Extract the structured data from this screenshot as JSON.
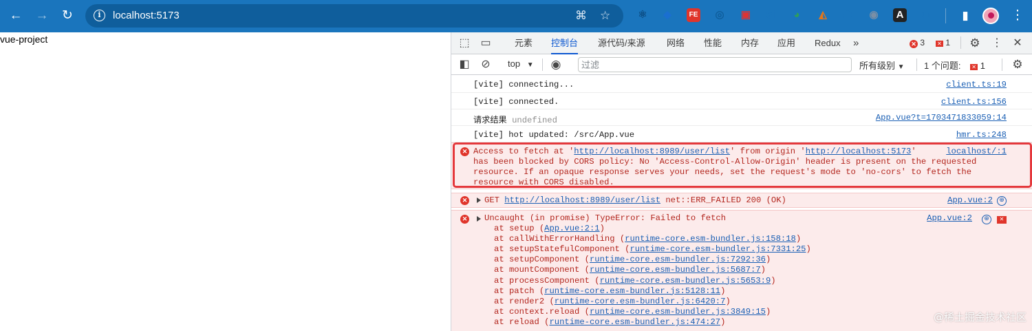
{
  "browser": {
    "url": "localhost:5173",
    "back_icon": "arrow-left-icon",
    "forward_icon": "arrow-right-icon",
    "reload_icon": "reload-icon",
    "extensions": [
      {
        "name": "react-devtools-icon",
        "glyph": "⚛",
        "color": "#0d4f86"
      },
      {
        "name": "dropbox-icon",
        "glyph": "◆",
        "color": "#1a6fd0"
      },
      {
        "name": "fe-extension-icon",
        "glyph": "FE",
        "color": "#e0352b"
      },
      {
        "name": "target-extension-icon",
        "glyph": "◎",
        "color": "#0f5e9c"
      },
      {
        "name": "bag-extension-icon",
        "glyph": "▣",
        "color": "#d33"
      },
      {
        "name": "si-extension-icon",
        "glyph": "$i",
        "color": "#1a75bd"
      },
      {
        "name": "globe-extension-icon",
        "glyph": "◕",
        "color": "#2e9e5b"
      },
      {
        "name": "metamask-icon",
        "glyph": "◭",
        "color": "#e2761b"
      },
      {
        "name": "bookmark-extension-icon",
        "glyph": "☗",
        "color": "#1a75bd"
      },
      {
        "name": "ball-extension-icon",
        "glyph": "◉",
        "color": "#7a8fa6"
      },
      {
        "name": "text-extension-icon",
        "glyph": "A",
        "color": "#222"
      },
      {
        "name": "puzzle-icon",
        "glyph": "⧉",
        "color": "#1a75bd"
      }
    ]
  },
  "page": {
    "heading": "vue-project"
  },
  "devtools": {
    "tabs": [
      "元素",
      "控制台",
      "源代码/来源",
      "网络",
      "性能",
      "内存",
      "应用",
      "Redux"
    ],
    "active_tab": "控制台",
    "error_count": "3",
    "issue_count": "1",
    "context": "top",
    "filter_placeholder": "过滤",
    "levels": "所有级别",
    "issues_label": "1 个问题:",
    "issues_badge": "1"
  },
  "console": {
    "logs": [
      {
        "text": "[vite] connecting...",
        "source": "client.ts:19"
      },
      {
        "text": "[vite] connected.",
        "source": "client.ts:156"
      },
      {
        "label": "请求结果",
        "value": "undefined",
        "source": "App.vue?t=1703471833059:14"
      },
      {
        "text": "[vite] hot updated: /src/App.vue",
        "source": "hmr.ts:248"
      }
    ],
    "cors_error": {
      "prefix": "Access to fetch at '",
      "url1": "http://localhost:8989/user/list",
      "mid": "' from origin '",
      "url2": "http://localhost:5173",
      "end": "'",
      "line2": "has been blocked by CORS policy: No 'Access-Control-Allow-Origin' header is present on the requested",
      "line3": "resource. If an opaque response serves your needs, set the request's mode to 'no-cors' to fetch the",
      "line4": "resource with CORS disabled.",
      "source": "localhost/:1"
    },
    "get_error": {
      "method": "GET",
      "url": "http://localhost:8989/user/list",
      "status": "net::ERR_FAILED 200 (OK)",
      "source": "App.vue:2"
    },
    "type_error": {
      "text": "Uncaught (in promise) TypeError: Failed to fetch",
      "source": "App.vue:2",
      "stack": [
        {
          "fn": "at setup (",
          "loc": "App.vue:2:1"
        },
        {
          "fn": "at callWithErrorHandling (",
          "loc": "runtime-core.esm-bundler.js:158:18"
        },
        {
          "fn": "at setupStatefulComponent (",
          "loc": "runtime-core.esm-bundler.js:7331:25"
        },
        {
          "fn": "at setupComponent (",
          "loc": "runtime-core.esm-bundler.js:7292:36"
        },
        {
          "fn": "at mountComponent (",
          "loc": "runtime-core.esm-bundler.js:5687:7"
        },
        {
          "fn": "at processComponent (",
          "loc": "runtime-core.esm-bundler.js:5653:9"
        },
        {
          "fn": "at patch (",
          "loc": "runtime-core.esm-bundler.js:5128:11"
        },
        {
          "fn": "at render2 (",
          "loc": "runtime-core.esm-bundler.js:6420:7"
        },
        {
          "fn": "at context.reload (",
          "loc": "runtime-core.esm-bundler.js:3849:15"
        },
        {
          "fn": "at reload (",
          "loc": "runtime-core.esm-bundler.js:474:27"
        }
      ]
    }
  },
  "watermark": "@稀土掘金技术社区"
}
